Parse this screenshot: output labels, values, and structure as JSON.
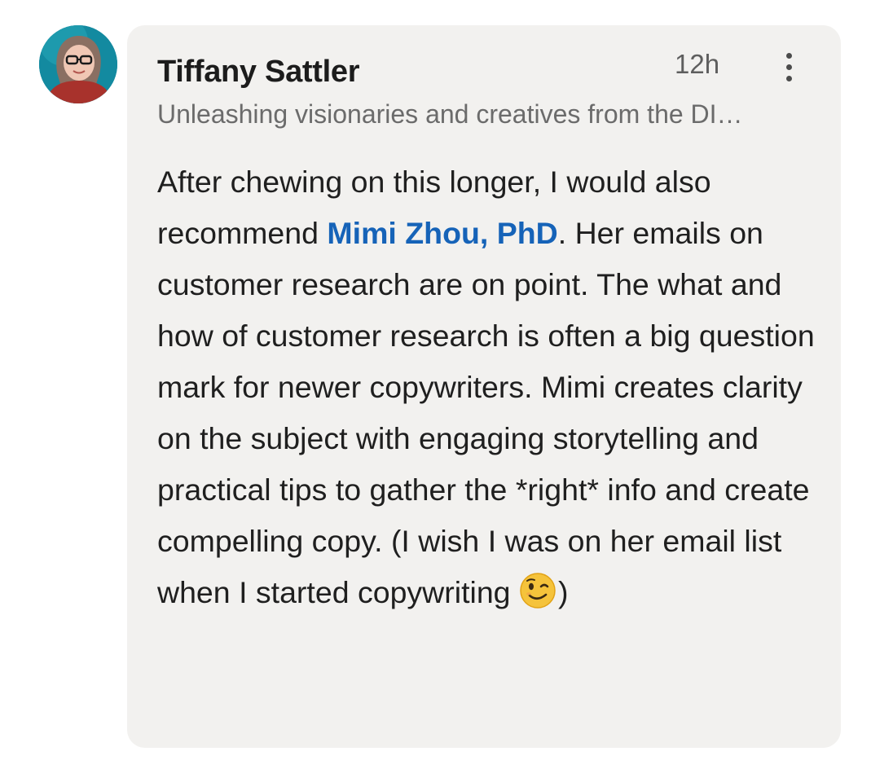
{
  "comment": {
    "author": {
      "name": "Tiffany Sattler",
      "headline": "Unleashing visionaries and creatives from the DI…"
    },
    "timestamp": "12h",
    "body": {
      "before_mention": "After chewing on this longer, I would also recommend ",
      "mention": "Mimi Zhou, PhD",
      "after_mention": ". Her emails on customer research are on point. The what and how of customer research is often a big question mark for newer copywriters. Mimi creates clarity on the subject with engaging storytelling and practical tips to gather the *right* info and create compelling copy. (I wish I was on her email list when I started copywriting ",
      "emoji": "winking-face",
      "closing": ")"
    },
    "icons": {
      "menu": "more-vertical-icon"
    },
    "colors": {
      "bubble_background": "#f2f1ef",
      "mention": "#1663b8"
    }
  }
}
